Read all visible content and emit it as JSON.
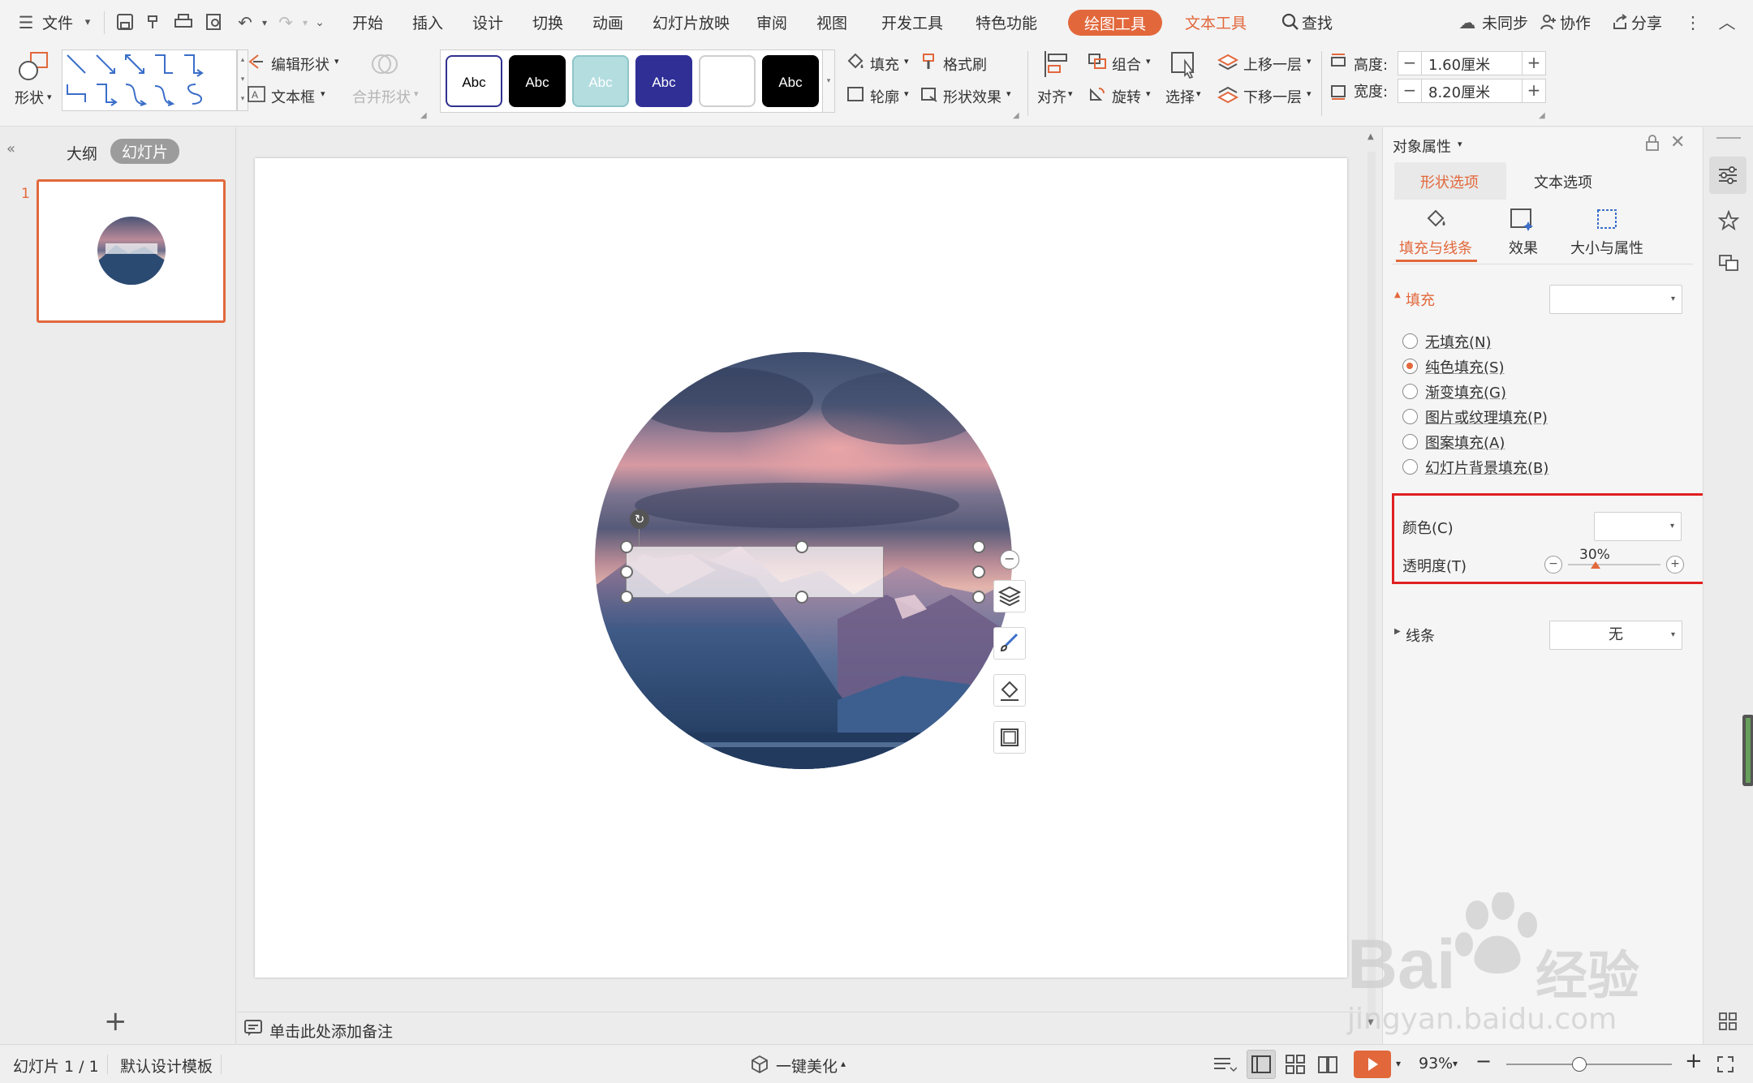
{
  "menubar": {
    "file_label": "文件",
    "items": [
      "开始",
      "插入",
      "设计",
      "切换",
      "动画",
      "幻灯片放映",
      "审阅",
      "视图",
      "开发工具",
      "特色功能"
    ],
    "drawing_tools": "绘图工具",
    "text_tools": "文本工具",
    "search": "查找",
    "unsynced": "未同步",
    "collaborate": "协作",
    "share": "分享"
  },
  "toolbar": {
    "shape_label": "形状",
    "edit_shape": "编辑形状",
    "text_box": "文本框",
    "merge_shape": "合并形状",
    "style_samples": [
      {
        "label": "Abc",
        "bg": "#ffffff",
        "fg": "#000000",
        "border": "#2f3190"
      },
      {
        "label": "Abc",
        "bg": "#000000",
        "fg": "#ffffff",
        "border": "#000000"
      },
      {
        "label": "Abc",
        "bg": "#b4dde0",
        "fg": "#ffffff",
        "border": "#8ec5c9"
      },
      {
        "label": "Abc",
        "bg": "#2f2f96",
        "fg": "#ffffff",
        "border": "#2f2f96"
      },
      {
        "label": "",
        "bg": "#ffffff",
        "fg": "#000000",
        "border": "#cfcfcf"
      },
      {
        "label": "Abc",
        "bg": "#000000",
        "fg": "#ffffff",
        "border": "#000000"
      }
    ],
    "fill": "填充",
    "format_painter": "格式刷",
    "outline": "轮廓",
    "shape_effect": "形状效果",
    "align": "对齐",
    "group": "组合",
    "rotate": "旋转",
    "select": "选择",
    "bring_forward": "上移一层",
    "send_backward": "下移一层",
    "height_label": "高度:",
    "height_value": "1.60厘米",
    "width_label": "宽度:",
    "width_value": "8.20厘米"
  },
  "left_panel": {
    "tab_outline": "大纲",
    "tab_slides": "幻灯片",
    "slide_number": "1",
    "add_label": "+"
  },
  "notes": {
    "placeholder": "单击此处添加备注"
  },
  "right_panel": {
    "title": "对象属性",
    "tab_shape": "形状选项",
    "tab_text": "文本选项",
    "sub_fill_line": "填充与线条",
    "sub_effect": "效果",
    "sub_size": "大小与属性",
    "fill_header": "填充",
    "fill_options": [
      {
        "label": "无填充(N)",
        "checked": false
      },
      {
        "label": "纯色填充(S)",
        "checked": true
      },
      {
        "label": "渐变填充(G)",
        "checked": false
      },
      {
        "label": "图片或纹理填充(P)",
        "checked": false
      },
      {
        "label": "图案填充(A)",
        "checked": false
      },
      {
        "label": "幻灯片背景填充(B)",
        "checked": false
      }
    ],
    "color_label": "颜色(C)",
    "transparency_label": "透明度(T)",
    "transparency_value": "30%",
    "transparency_fraction": 0.3,
    "line_header": "线条",
    "line_value": "无"
  },
  "statusbar": {
    "slide_info": "幻灯片 1 / 1",
    "template": "默认设计模板",
    "beautify": "一键美化",
    "zoom": "93%"
  },
  "watermark": {
    "brand": "Bai",
    "brand2": "经验",
    "url": "jingyan.baidu.com"
  },
  "colors": {
    "accent": "#e2683c",
    "highlight_box": "#e02020"
  }
}
